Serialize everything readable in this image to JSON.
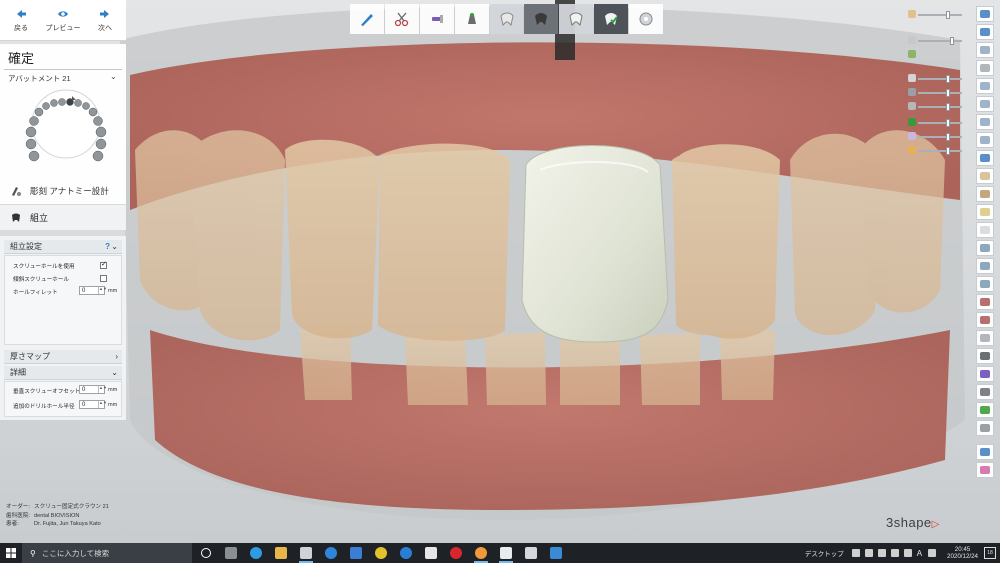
{
  "nav": {
    "back_label": "戻る",
    "preview_label": "プレビュー",
    "next_label": "次へ"
  },
  "step": {
    "title": "確定",
    "tooth_selector_label": "アバットメント 21",
    "sculpt_label": "彫刻 アナトミー設計",
    "assembly_label": "組立"
  },
  "assembly_settings": {
    "title": "組立設定",
    "help": "?",
    "use_screw_hole_label": "スクリューホールを使用",
    "use_screw_hole_checked": true,
    "angled_screw_hole_label": "傾斜スクリューホール",
    "angled_screw_hole_checked": false,
    "hole_fillet_label": "ホールフィレット",
    "hole_fillet_value": "0",
    "hole_fillet_unit": "mm"
  },
  "thickness_map": {
    "title": "厚さマップ"
  },
  "details": {
    "title": "詳細",
    "vertical_offset_label": "垂直スクリューオフセット",
    "vertical_offset_value": "0",
    "vertical_offset_unit": "mm",
    "drill_radius_label": "追加のドリルホール半径",
    "drill_radius_value": "0",
    "drill_radius_unit": "mm"
  },
  "order_info": {
    "order_key": "オーダー:",
    "order_value": "スクリュー固定式クラウン 21",
    "clinic_key": "歯科医院:",
    "clinic_value": "dental BIOVISION",
    "patient_key": "患者:",
    "patient_value": "Dr. Fujita, Jun Takuya Kato"
  },
  "brand": {
    "logo_text": "3shape"
  },
  "taskbar": {
    "search_placeholder": "ここに入力して検索",
    "desktop_label": "デスクトップ",
    "ime_label": "A",
    "time": "20:45",
    "date": "2020/12/24",
    "notification_count": "18"
  },
  "colors": {
    "accent": "#2f7fc4",
    "gingiva": "#b36458",
    "crown": "#dfe3d4",
    "taskbar": "#1e2227",
    "brand_mark": "#d43a2f"
  },
  "icons": {
    "back": "arrow-left-icon",
    "preview": "eye-icon",
    "next": "arrow-right-icon",
    "search": "magnifier-icon",
    "windows": "windows-logo-icon"
  }
}
